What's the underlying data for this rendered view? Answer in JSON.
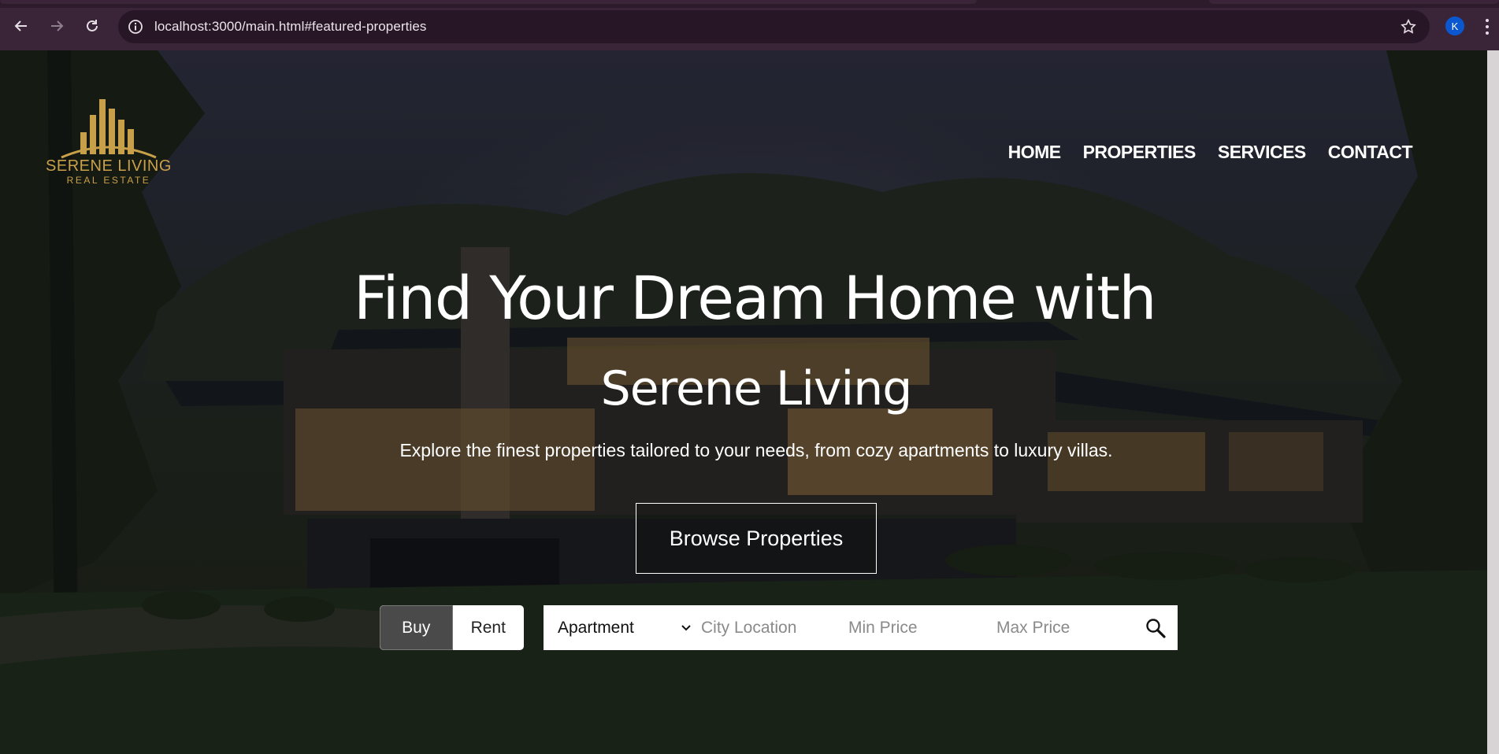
{
  "browser": {
    "url": "localhost:3000/main.html#featured-properties",
    "profile_initial": "K"
  },
  "logo": {
    "brand": "SERENE LIVING",
    "sub": "REAL ESTATE",
    "accent": "#c9a04a"
  },
  "nav": {
    "items": [
      "HOME",
      "PROPERTIES",
      "SERVICES",
      "CONTACT"
    ]
  },
  "hero": {
    "title_line1": "Find Your Dream Home with",
    "title_line2": "Serene Living",
    "tagline": "Explore the finest properties tailored to your needs, from cozy apartments to luxury villas.",
    "cta": "Browse Properties"
  },
  "search": {
    "modes": [
      "Buy",
      "Rent"
    ],
    "active_mode": "Buy",
    "property_type": "Apartment",
    "city_placeholder": "City Location",
    "min_price_placeholder": "Min Price",
    "max_price_placeholder": "Max Price"
  }
}
